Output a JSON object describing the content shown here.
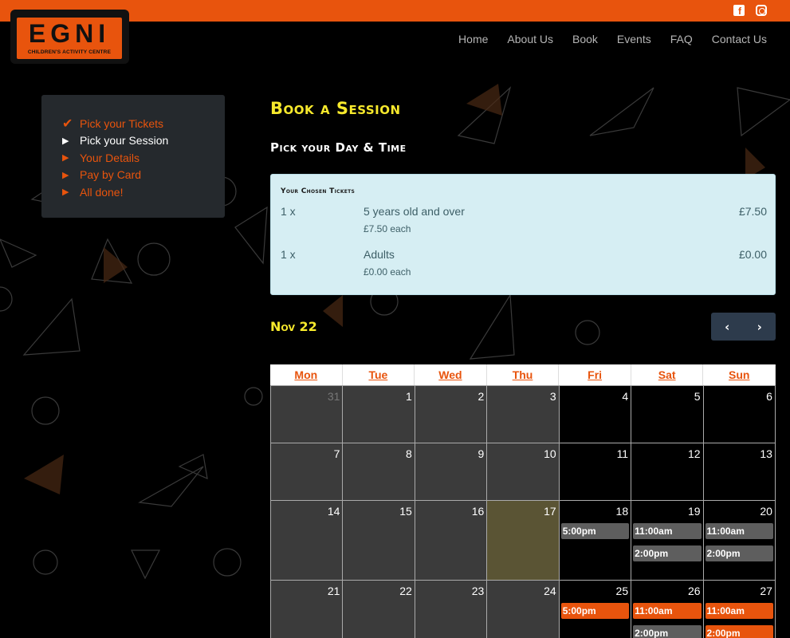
{
  "logo": {
    "letters": "EGNI",
    "subtitle": "CHILDREN'S ACTIVITY CENTRE"
  },
  "social": {
    "facebook": "f"
  },
  "nav": [
    "Home",
    "About Us",
    "Book",
    "Events",
    "FAQ",
    "Contact Us"
  ],
  "steps": [
    {
      "label": "Pick your Tickets",
      "state": "done"
    },
    {
      "label": "Pick your Session",
      "state": "current"
    },
    {
      "label": "Your Details",
      "state": "todo"
    },
    {
      "label": "Pay by Card",
      "state": "todo"
    },
    {
      "label": "All done!",
      "state": "todo"
    }
  ],
  "page": {
    "title": "Book a Session",
    "subtitle": "Pick your Day & Time"
  },
  "tickets": {
    "heading": "Your Chosen Tickets",
    "rows": [
      {
        "qty": "1 x",
        "name": "5 years old and over",
        "each": "£7.50 each",
        "price": "£7.50"
      },
      {
        "qty": "1 x",
        "name": "Adults",
        "each": "£0.00 each",
        "price": "£0.00"
      }
    ]
  },
  "calendar": {
    "month": "Nov 22",
    "prev_label": "‹",
    "next_label": "›",
    "weekdays": [
      "Mon",
      "Tue",
      "Wed",
      "Thu",
      "Fri",
      "Sat",
      "Sun"
    ],
    "weeks": [
      {
        "days": [
          {
            "n": "31",
            "type": "other"
          },
          {
            "n": "1",
            "type": "past"
          },
          {
            "n": "2",
            "type": "past"
          },
          {
            "n": "3",
            "type": "past"
          },
          {
            "n": "4",
            "type": "open"
          },
          {
            "n": "5",
            "type": "open"
          },
          {
            "n": "6",
            "type": "open"
          }
        ]
      },
      {
        "days": [
          {
            "n": "7",
            "type": "past"
          },
          {
            "n": "8",
            "type": "past"
          },
          {
            "n": "9",
            "type": "past"
          },
          {
            "n": "10",
            "type": "past"
          },
          {
            "n": "11",
            "type": "open"
          },
          {
            "n": "12",
            "type": "open"
          },
          {
            "n": "13",
            "type": "open"
          }
        ]
      },
      {
        "days": [
          {
            "n": "14",
            "type": "past"
          },
          {
            "n": "15",
            "type": "past"
          },
          {
            "n": "16",
            "type": "past"
          },
          {
            "n": "17",
            "type": "today"
          },
          {
            "n": "18",
            "type": "open",
            "slots": [
              {
                "time": "5:00pm",
                "style": "grey"
              }
            ]
          },
          {
            "n": "19",
            "type": "open",
            "slots": [
              {
                "time": "11:00am",
                "style": "grey"
              },
              {
                "time": "2:00pm",
                "style": "grey"
              }
            ]
          },
          {
            "n": "20",
            "type": "open",
            "slots": [
              {
                "time": "11:00am",
                "style": "grey"
              },
              {
                "time": "2:00pm",
                "style": "grey"
              }
            ]
          }
        ]
      },
      {
        "days": [
          {
            "n": "21",
            "type": "past"
          },
          {
            "n": "22",
            "type": "past"
          },
          {
            "n": "23",
            "type": "past"
          },
          {
            "n": "24",
            "type": "past"
          },
          {
            "n": "25",
            "type": "open",
            "slots": [
              {
                "time": "5:00pm",
                "style": "orange"
              }
            ]
          },
          {
            "n": "26",
            "type": "open",
            "slots": [
              {
                "time": "11:00am",
                "style": "orange"
              },
              {
                "time": "2:00pm",
                "style": "grey"
              }
            ]
          },
          {
            "n": "27",
            "type": "open",
            "slots": [
              {
                "time": "11:00am",
                "style": "orange"
              },
              {
                "time": "2:00pm",
                "style": "orange"
              }
            ]
          }
        ]
      }
    ]
  },
  "colors": {
    "accent": "#e8540d",
    "title": "#f7e92c",
    "panel": "#25292d",
    "tickets_bg": "#d6eef3"
  }
}
